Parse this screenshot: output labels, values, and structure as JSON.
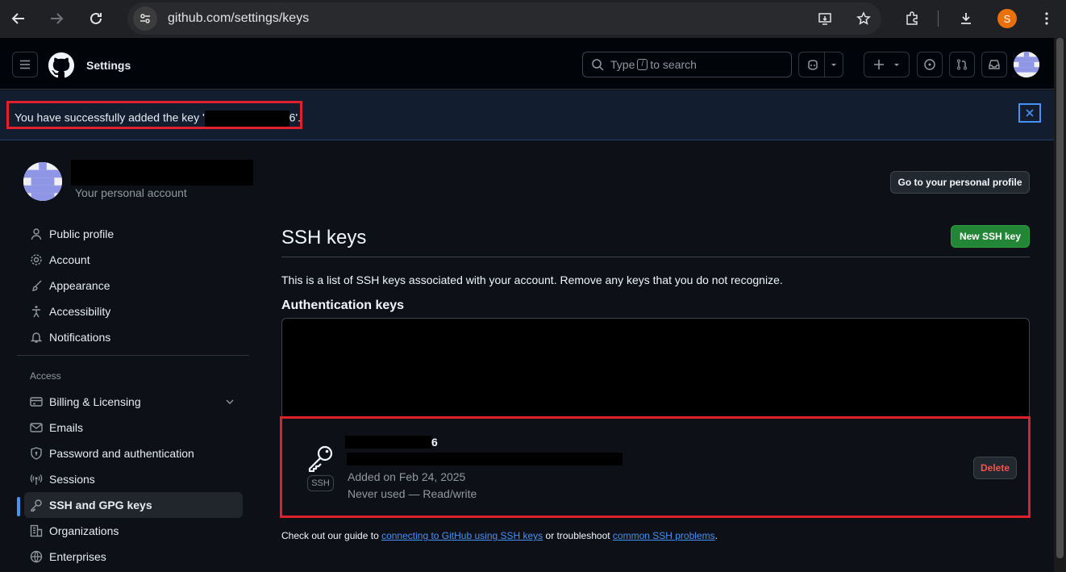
{
  "browser": {
    "url": "github.com/settings/keys",
    "profile_initial": "S"
  },
  "header": {
    "title": "Settings",
    "search_placeholder_pre": "Type",
    "search_key": "/",
    "search_placeholder_post": "to search"
  },
  "flash": {
    "message_pre": "You have successfully added the key '",
    "message_post": "6'."
  },
  "account": {
    "subtitle": "Your personal account"
  },
  "sidebar": {
    "items": [
      {
        "label": "Public profile",
        "icon": "person-icon"
      },
      {
        "label": "Account",
        "icon": "gear-icon"
      },
      {
        "label": "Appearance",
        "icon": "paintbrush-icon"
      },
      {
        "label": "Accessibility",
        "icon": "accessibility-icon"
      },
      {
        "label": "Notifications",
        "icon": "bell-icon"
      }
    ],
    "section_access": "Access",
    "access_items": [
      {
        "label": "Billing & Licensing",
        "icon": "credit-card-icon"
      },
      {
        "label": "Emails",
        "icon": "mail-icon"
      },
      {
        "label": "Password and authentication",
        "icon": "shield-lock-icon"
      },
      {
        "label": "Sessions",
        "icon": "broadcast-icon"
      },
      {
        "label": "SSH and GPG keys",
        "icon": "key-icon",
        "active": true
      },
      {
        "label": "Organizations",
        "icon": "organization-icon"
      },
      {
        "label": "Enterprises",
        "icon": "globe-icon"
      }
    ]
  },
  "main": {
    "profile_button": "Go to your personal profile",
    "title": "SSH keys",
    "new_key_button": "New SSH key",
    "description": "This is a list of SSH keys associated with your account. Remove any keys that you do not recognize.",
    "auth_keys_heading": "Authentication keys",
    "key": {
      "title_suffix": "6",
      "type_label": "SSH",
      "added": "Added on Feb 24, 2025",
      "usage": "Never used — Read/write",
      "delete_label": "Delete"
    },
    "guide": {
      "pre": "Check out our guide to ",
      "link1": "connecting to GitHub using SSH keys",
      "mid": " or troubleshoot ",
      "link2": "common SSH problems",
      "post": "."
    }
  },
  "colors": {
    "accent": "#4493f8",
    "success": "#238636",
    "danger": "#f85149",
    "highlight_border": "#e0202d"
  }
}
